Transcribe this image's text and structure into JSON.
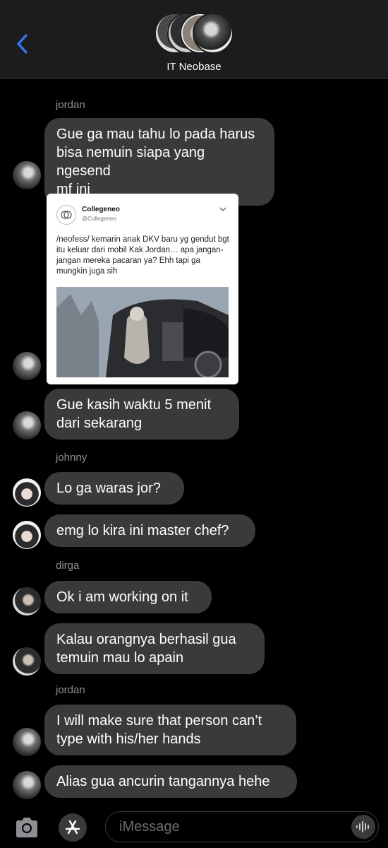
{
  "header": {
    "back_icon": "chevron-left-icon",
    "group_name": "IT Neobase"
  },
  "messages": [
    {
      "sender": "jordan",
      "text": "Gue ga mau tahu lo pada harus\nbisa nemuin siapa yang ngesend\nmf ini"
    },
    {
      "tweet": {
        "account_name": "Collegeneo",
        "handle": "@Collegeneo",
        "text": "/neofess/ kemarin anak DKV baru yg gendut bgt  itu keluar dari mobil Kak Jordan… apa jangan-jangan mereka pacaran ya? Ehh tapi ga mungkin juga sih"
      }
    },
    {
      "text": "Gue kasih waktu 5 menit\ndari sekarang"
    },
    {
      "sender": "johnny",
      "text": "Lo ga waras jor?"
    },
    {
      "text": "emg lo kira ini master chef?"
    },
    {
      "sender": "dirga",
      "text": "Ok i am working on it"
    },
    {
      "text": "Kalau orangnya berhasil gua\ntemuin mau lo apain"
    },
    {
      "sender": "jordan",
      "text": "I will make sure that person can’t\ntype with his/her hands"
    },
    {
      "text": "Alias gua ancurin tangannya hehe"
    }
  ],
  "composer": {
    "camera_icon": "camera-icon",
    "apps_icon": "app-store-icon",
    "placeholder": "iMessage",
    "voice_icon": "waveform-icon"
  },
  "colors": {
    "accent": "#3478f6",
    "bubble": "#3a3a3c",
    "background": "#000000",
    "header": "#1c1c1e",
    "sender_label": "#8e8e93"
  }
}
